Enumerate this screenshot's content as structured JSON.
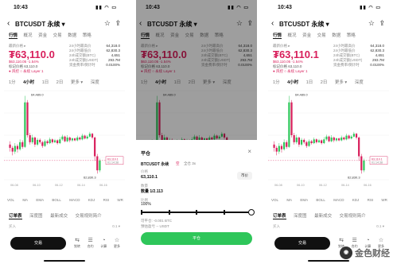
{
  "status": {
    "time": "10:43",
    "icons": "▮▮ ◠ ▭"
  },
  "header": {
    "back_icon": "‹",
    "symbol": "BTCUSDT 永续 ▾",
    "star_icon": "☆",
    "share_icon": "⇪"
  },
  "tabs": [
    "行情",
    "概况",
    "资金",
    "交易",
    "数据",
    "策略"
  ],
  "last_price_label": "最新价格 ▸",
  "price": "₮63,110.0",
  "price_alt": "₮63,110.1",
  "sub_price": "$63,110.05  -1.54%",
  "mark_line": "标记价格 63,110.0",
  "tags": "● 风控  ○ 永续  Layer 1",
  "stats": [
    {
      "label": "24小时最高价",
      "value": "64,318.0"
    },
    {
      "label": "24小时最低价",
      "value": "62,830.3"
    },
    {
      "label": "24h成交额(BTC)",
      "value": "4,651"
    },
    {
      "label": "24h成交额(USDT)",
      "value": "293.7M"
    },
    {
      "label": "资金费率/倒计时",
      "value": "0.0100%"
    }
  ],
  "intervals": [
    "1分",
    "4小时",
    "1日",
    "2日",
    "更多 ▾",
    "深度"
  ],
  "chart_labels": {
    "high": "64,489.0",
    "low": "62,830.3",
    "last": "63,110.1",
    "countdown": "01:14:38"
  },
  "xaxis": [
    "06-08",
    "06-10",
    "06-12",
    "06-14",
    "06-16"
  ],
  "indicators": [
    "VOL",
    "MA",
    "EMA",
    "BOLL",
    "MACD",
    "KDJ",
    "RSI",
    "WR"
  ],
  "bottom_tabs": [
    "订单表",
    "深度图",
    "最新成交",
    "交易规则简介"
  ],
  "position_label": "买入",
  "position_right": "0.1 ▾",
  "trade_button": "交易",
  "bottom_icons": [
    {
      "glyph": "⇆",
      "label": "划转"
    },
    {
      "glyph": "☰",
      "label": "合约"
    },
    {
      "glyph": "◔",
      "label": "计算"
    },
    {
      "glyph": "☆",
      "label": "更多"
    }
  ],
  "sheet": {
    "title": "平仓",
    "close_icon": "×",
    "symbol": "BTCUSDT 永续",
    "side": "空",
    "leverage": "全仓 3x",
    "price_label": "价格",
    "price_value": "63,110.1",
    "market_btn": "市价",
    "qty_label": "数量",
    "qty_value": "数量 1/2.113",
    "pct_label": "比例",
    "pct_value": "100%",
    "est1": "可平仓: -0.001 BTC",
    "est2": "预估盈亏 -- USDT",
    "confirm_button": "平仓"
  },
  "watermark": "金色财经",
  "chart_data": {
    "type": "candlestick",
    "series": [
      {
        "o": 63450,
        "c": 63380,
        "h": 63520,
        "l": 63300
      },
      {
        "o": 63380,
        "c": 63300,
        "h": 63420,
        "l": 63220
      },
      {
        "o": 63300,
        "c": 63420,
        "h": 63480,
        "l": 63250
      },
      {
        "o": 63420,
        "c": 63350,
        "h": 63460,
        "l": 63280
      },
      {
        "o": 63350,
        "c": 63500,
        "h": 63560,
        "l": 63320
      },
      {
        "o": 63500,
        "c": 63400,
        "h": 63540,
        "l": 63360
      },
      {
        "o": 63400,
        "c": 64350,
        "h": 64489,
        "l": 63380
      },
      {
        "o": 64350,
        "c": 63650,
        "h": 64400,
        "l": 63600
      },
      {
        "o": 63650,
        "c": 63500,
        "h": 63700,
        "l": 63450
      },
      {
        "o": 63500,
        "c": 63600,
        "h": 63660,
        "l": 63460
      },
      {
        "o": 63600,
        "c": 63450,
        "h": 63620,
        "l": 63400
      },
      {
        "o": 63450,
        "c": 63550,
        "h": 63590,
        "l": 63420
      },
      {
        "o": 63550,
        "c": 63500,
        "h": 63580,
        "l": 63460
      },
      {
        "o": 63500,
        "c": 63420,
        "h": 63530,
        "l": 63380
      },
      {
        "o": 63420,
        "c": 63520,
        "h": 63560,
        "l": 63400
      },
      {
        "o": 63520,
        "c": 63480,
        "h": 63550,
        "l": 63450
      },
      {
        "o": 63480,
        "c": 63560,
        "h": 63600,
        "l": 63460
      },
      {
        "o": 63560,
        "c": 63500,
        "h": 63580,
        "l": 63470
      },
      {
        "o": 63500,
        "c": 63540,
        "h": 63570,
        "l": 63480
      },
      {
        "o": 63540,
        "c": 63480,
        "h": 63560,
        "l": 63450
      },
      {
        "o": 63480,
        "c": 63560,
        "h": 63610,
        "l": 63460
      },
      {
        "o": 63560,
        "c": 63620,
        "h": 63660,
        "l": 63530
      },
      {
        "o": 63620,
        "c": 63520,
        "h": 63640,
        "l": 63500
      },
      {
        "o": 63520,
        "c": 63600,
        "h": 63650,
        "l": 63500
      },
      {
        "o": 63600,
        "c": 63540,
        "h": 63620,
        "l": 63500
      },
      {
        "o": 63540,
        "c": 63580,
        "h": 63600,
        "l": 63510
      },
      {
        "o": 63580,
        "c": 63540,
        "h": 63600,
        "l": 63520
      },
      {
        "o": 63540,
        "c": 63600,
        "h": 63640,
        "l": 63520
      },
      {
        "o": 63600,
        "c": 63560,
        "h": 63620,
        "l": 63540
      },
      {
        "o": 63560,
        "c": 63640,
        "h": 63680,
        "l": 63540
      },
      {
        "o": 63640,
        "c": 63580,
        "h": 63660,
        "l": 63560
      },
      {
        "o": 63580,
        "c": 63620,
        "h": 63650,
        "l": 63560
      },
      {
        "o": 63620,
        "c": 63680,
        "h": 63720,
        "l": 63600
      },
      {
        "o": 63680,
        "c": 63600,
        "h": 63700,
        "l": 63560
      },
      {
        "o": 63600,
        "c": 63200,
        "h": 63620,
        "l": 63100
      },
      {
        "o": 63200,
        "c": 62900,
        "h": 63250,
        "l": 62830
      },
      {
        "o": 62900,
        "c": 63110,
        "h": 63150,
        "l": 62860
      }
    ],
    "ylim": [
      62700,
      64600
    ]
  }
}
